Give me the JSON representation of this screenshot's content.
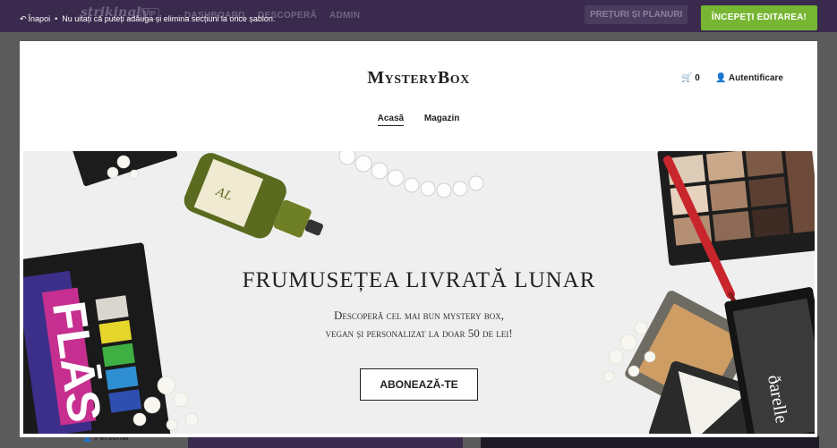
{
  "app_bar": {
    "brand": "strikingly",
    "brand_badge": "VIP",
    "nav": [
      "DASHBOARD",
      "DESCOPERĂ",
      "ADMIN"
    ],
    "pricing_label": "PREȚURI ȘI PLANURI",
    "start_editing_label": "ÎNCEPEȚI EDITAREA!",
    "accent_color": "#77b632"
  },
  "notice": {
    "back_label": "Înapoi",
    "message": "Nu uitați că puteți adăuga și elimina secțiuni la orice șablon."
  },
  "background": {
    "personal_label": "Personal"
  },
  "site": {
    "logo": "MysteryBox",
    "cart_count": "0",
    "login_label": "Autentificare",
    "menu": [
      "Acasă",
      "Magazin"
    ],
    "hero": {
      "title": "Frumusețea livrată lunar",
      "subtitle_line1": "Descoperă cel mai bun mystery box,",
      "subtitle_line2": "vegan și personalizat la doar 50 de lei!",
      "button_label": "ABONEAZĂ-TE",
      "palette_text": "FLĀS",
      "lashes_text": "ðarelle"
    }
  }
}
